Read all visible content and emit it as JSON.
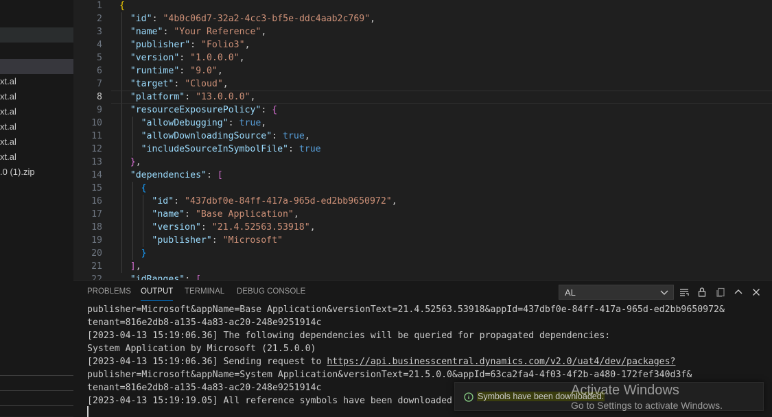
{
  "sidebar": {
    "files": [
      "xt.al",
      "xt.al",
      "xt.al",
      "xt.al",
      "xt.al",
      "xt.al",
      ".0 (1).zip"
    ]
  },
  "editor": {
    "active_line": 8,
    "lines": [
      [
        [
          "br1",
          "{"
        ]
      ],
      [
        [
          "k",
          "\"id\""
        ],
        [
          "p",
          ": "
        ],
        [
          "s",
          "\"4b0c06d7-32a2-4cc3-bf5e-ddc4aab2c769\""
        ],
        [
          "p",
          ","
        ]
      ],
      [
        [
          "k",
          "\"name\""
        ],
        [
          "p",
          ": "
        ],
        [
          "s",
          "\"Your Reference\""
        ],
        [
          "p",
          ","
        ]
      ],
      [
        [
          "k",
          "\"publisher\""
        ],
        [
          "p",
          ": "
        ],
        [
          "s",
          "\"Folio3\""
        ],
        [
          "p",
          ","
        ]
      ],
      [
        [
          "k",
          "\"version\""
        ],
        [
          "p",
          ": "
        ],
        [
          "s",
          "\"1.0.0.0\""
        ],
        [
          "p",
          ","
        ]
      ],
      [
        [
          "k",
          "\"runtime\""
        ],
        [
          "p",
          ": "
        ],
        [
          "s",
          "\"9.0\""
        ],
        [
          "p",
          ","
        ]
      ],
      [
        [
          "k",
          "\"target\""
        ],
        [
          "p",
          ": "
        ],
        [
          "s",
          "\"Cloud\""
        ],
        [
          "p",
          ","
        ]
      ],
      [
        [
          "k",
          "\"platform\""
        ],
        [
          "p",
          ": "
        ],
        [
          "s",
          "\"13.0.0.0\""
        ],
        [
          "p",
          ","
        ]
      ],
      [
        [
          "k",
          "\"resourceExposurePolicy\""
        ],
        [
          "p",
          ": "
        ],
        [
          "br2",
          "{"
        ]
      ],
      [
        [
          "k",
          "\"allowDebugging\""
        ],
        [
          "p",
          ": "
        ],
        [
          "b",
          "true"
        ],
        [
          "p",
          ","
        ]
      ],
      [
        [
          "k",
          "\"allowDownloadingSource\""
        ],
        [
          "p",
          ": "
        ],
        [
          "b",
          "true"
        ],
        [
          "p",
          ","
        ]
      ],
      [
        [
          "k",
          "\"includeSourceInSymbolFile\""
        ],
        [
          "p",
          ": "
        ],
        [
          "b",
          "true"
        ]
      ],
      [
        [
          "br2",
          "}"
        ],
        [
          "p",
          ","
        ]
      ],
      [
        [
          "k",
          "\"dependencies\""
        ],
        [
          "p",
          ": "
        ],
        [
          "br2",
          "["
        ]
      ],
      [
        [
          "br3",
          "{"
        ]
      ],
      [
        [
          "k",
          "\"id\""
        ],
        [
          "p",
          ": "
        ],
        [
          "s",
          "\"437dbf0e-84ff-417a-965d-ed2bb9650972\""
        ],
        [
          "p",
          ","
        ]
      ],
      [
        [
          "k",
          "\"name\""
        ],
        [
          "p",
          ": "
        ],
        [
          "s",
          "\"Base Application\""
        ],
        [
          "p",
          ","
        ]
      ],
      [
        [
          "k",
          "\"version\""
        ],
        [
          "p",
          ": "
        ],
        [
          "s",
          "\"21.4.52563.53918\""
        ],
        [
          "p",
          ","
        ]
      ],
      [
        [
          "k",
          "\"publisher\""
        ],
        [
          "p",
          ": "
        ],
        [
          "s",
          "\"Microsoft\""
        ]
      ],
      [
        [
          "br3",
          "}"
        ]
      ],
      [
        [
          "br2",
          "]"
        ],
        [
          "p",
          ","
        ]
      ],
      [
        [
          "k",
          "\"idRanges\""
        ],
        [
          "p",
          ": "
        ],
        [
          "br2",
          "["
        ]
      ]
    ]
  },
  "panel": {
    "tabs": [
      "PROBLEMS",
      "OUTPUT",
      "TERMINAL",
      "DEBUG CONSOLE"
    ],
    "active_tab": "OUTPUT",
    "channel": "AL",
    "output_lines": [
      "publisher=Microsoft&appName=Base Application&versionText=21.4.52563.53918&appId=437dbf0e-84ff-417a-965d-ed2bb9650972&",
      "tenant=816e2db8-a135-4a83-ac20-248e9251914c",
      "[2023-04-13 15:19:06.36] The following dependencies will be queried for propagated dependencies:",
      "System Application by Microsoft (21.5.0.0)",
      "[2023-04-13 15:19:06.36] Sending request to ",
      "publisher=Microsoft&appName=System Application&versionText=21.5.0.0&appId=63ca2fa4-4f03-4f2b-a480-172fef340d3f&",
      "tenant=816e2db8-a135-4a83-ac20-248e9251914c",
      "[2023-04-13 15:19:19.05] All reference symbols have been downloaded."
    ],
    "request_url": "https://api.businesscentral.dynamics.com/v2.0/uat4/dev/packages?"
  },
  "notification": {
    "message": "Symbols have been downloaded.",
    "icon": "info-icon"
  },
  "watermark": {
    "title": "Activate Windows",
    "subtitle": "Go to Settings to activate Windows."
  },
  "colors": {
    "key": "#9cdcfe",
    "string": "#ce9178",
    "boolean": "#569cd6",
    "accent": "#0078d4",
    "info": "#89d185"
  }
}
